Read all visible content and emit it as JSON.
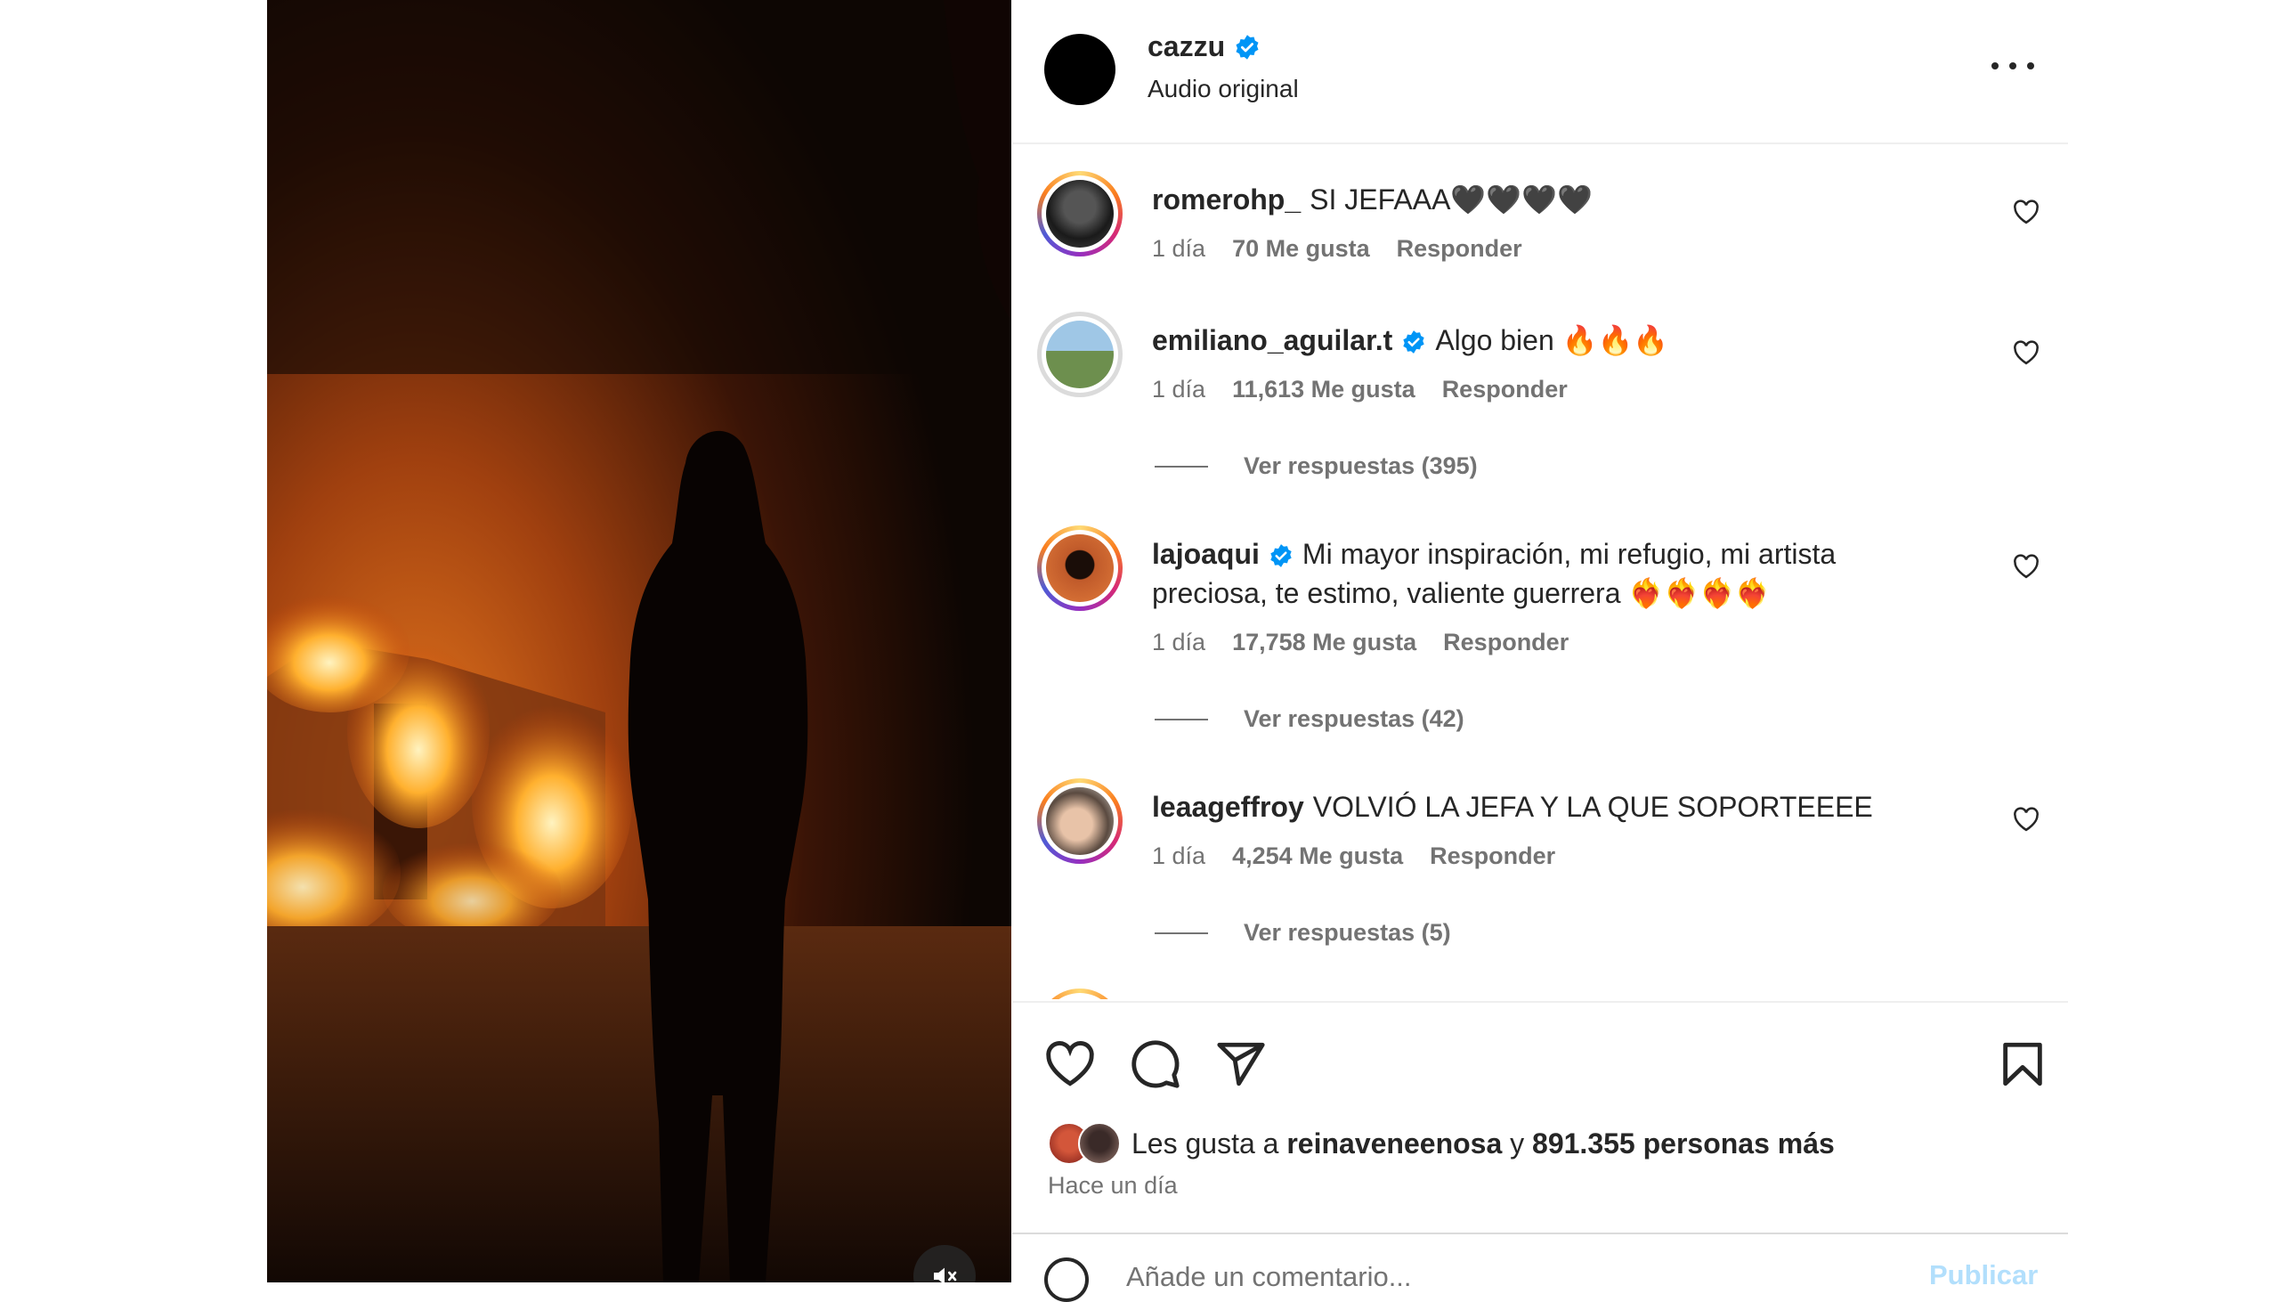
{
  "post": {
    "author": "cazzu",
    "audio": "Audio original"
  },
  "comments": [
    {
      "user": "romerohp_",
      "verified": false,
      "text": "SI JEFAAA🖤🖤🖤🖤",
      "age": "1 día",
      "likes": "70 Me gusta",
      "reply": "Responder",
      "replies": ""
    },
    {
      "user": "emiliano_aguilar.t",
      "verified": true,
      "text": "Algo bien 🔥🔥🔥",
      "age": "1 día",
      "likes": "11,613 Me gusta",
      "reply": "Responder",
      "replies": "Ver respuestas (395)"
    },
    {
      "user": "lajoaqui",
      "verified": true,
      "text": "Mi mayor inspiración, mi refugio, mi artista preciosa, te estimo, valiente guerrera ❤️‍🔥❤️‍🔥❤️‍🔥❤️‍🔥",
      "age": "1 día",
      "likes": "17,758 Me gusta",
      "reply": "Responder",
      "replies": "Ver respuestas (42)"
    },
    {
      "user": "leaageffroy",
      "verified": false,
      "text": "VOLVIÓ LA JEFA Y LA QUE SOPORTEEEE",
      "age": "1 día",
      "likes": "4,254 Me gusta",
      "reply": "Responder",
      "replies": "Ver respuestas (5)"
    }
  ],
  "likes": {
    "prefix": "Les gusta a",
    "user": "reinaveneenosa",
    "connector": "y",
    "others": "891.355 personas más"
  },
  "time_ago": "Hace un día",
  "add_comment": {
    "placeholder": "Añade un comentario...",
    "post_label": "Publicar"
  },
  "icons": {
    "verified": "verified-badge-icon",
    "more": "more-options-icon",
    "like": "heart-icon",
    "comment": "comment-icon",
    "share": "share-icon",
    "save": "bookmark-icon",
    "mute": "muted-speaker-icon",
    "emoji": "emoji-icon"
  },
  "colors": {
    "verified_blue": "#0095f6",
    "text": "#262626",
    "secondary": "#737373",
    "publish_disabled": "#b2dffc"
  }
}
